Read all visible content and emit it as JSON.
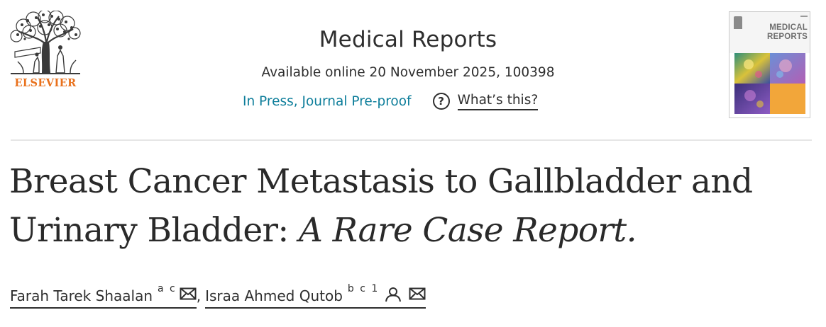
{
  "header": {
    "publisher": "ELSEVIER",
    "journal_title": "Medical Reports",
    "available_online": "Available online 20 November 2025, 100398",
    "status_link": "In Press, Journal Pre-proof",
    "help_label": "What’s this?",
    "cover_title_line1": "MEDICAL",
    "cover_title_line2": "REPORTS",
    "icons": {
      "help": "question-circle-icon",
      "email": "envelope-icon",
      "person": "person-icon"
    },
    "colors": {
      "publisher": "#e9711c",
      "link": "#0c7d9a"
    }
  },
  "article": {
    "title_plain": "Breast Cancer Metastasis to Gallbladder and Urinary Bladder:",
    "title_italic": "A Rare Case Report."
  },
  "authors": [
    {
      "name": "Farah Tarek Shaalan",
      "affiliations": "a c"
    },
    {
      "name": "Israa Ahmed Qutob",
      "affiliations": "b c 1"
    }
  ],
  "author_separator": ","
}
